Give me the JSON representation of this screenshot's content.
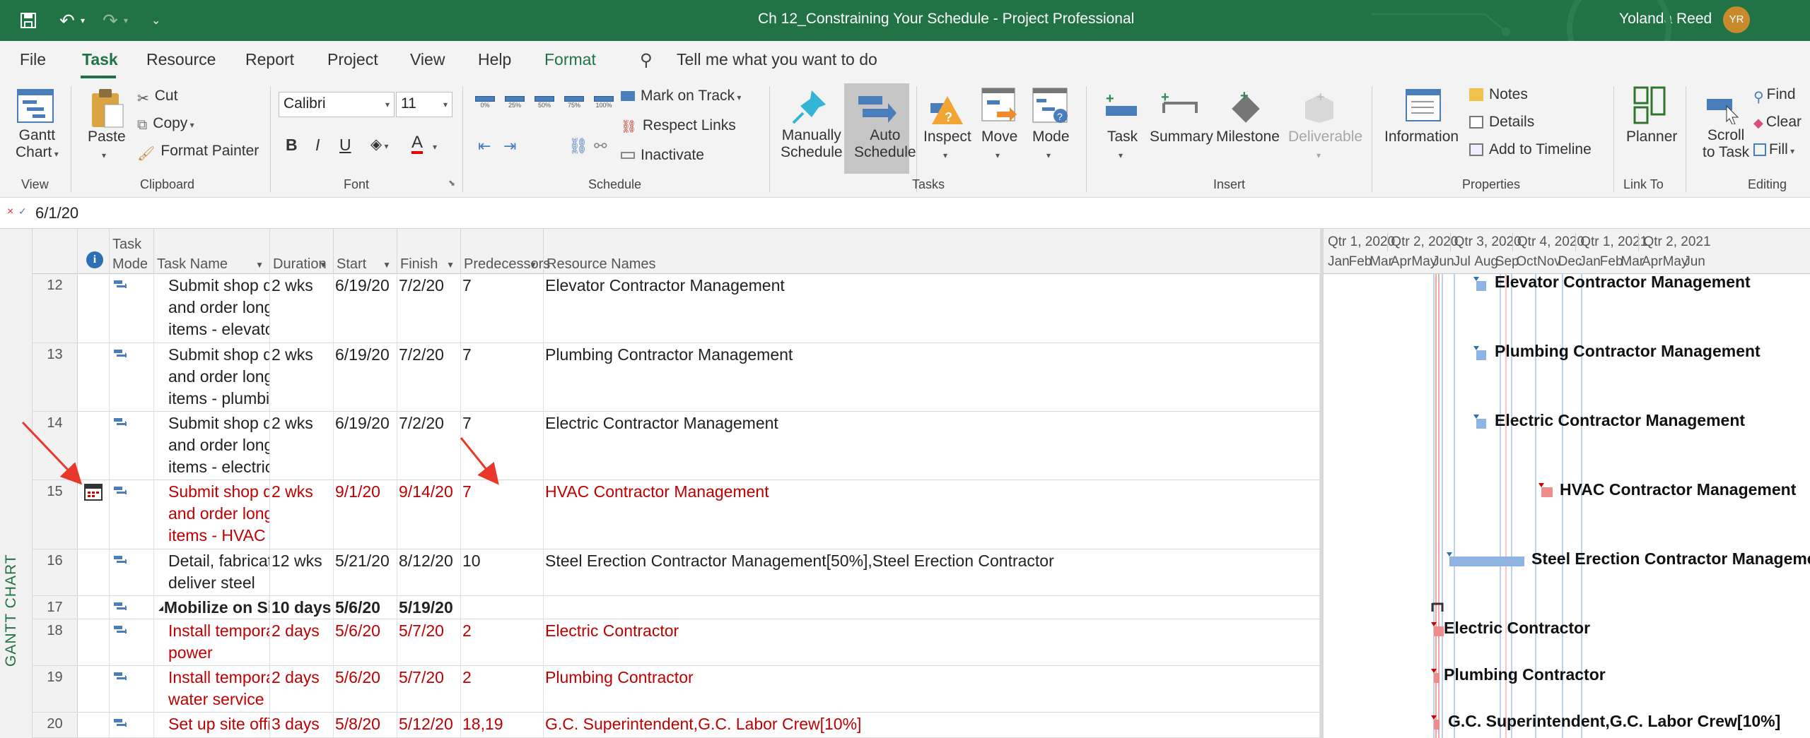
{
  "title_bar": {
    "document_title": "Ch 12_Constraining Your Schedule  -  Project Professional",
    "user_name": "Yolanda Reed",
    "user_initials": "YR",
    "qat_icons": [
      "save-icon",
      "undo-icon",
      "redo-icon",
      "customize-icon"
    ]
  },
  "menu": {
    "items": [
      "File",
      "Task",
      "Resource",
      "Report",
      "Project",
      "View",
      "Help",
      "Format"
    ],
    "active": "Task",
    "tell_me": "Tell me what you want to do"
  },
  "ribbon": {
    "view": {
      "gantt_chart": "Gantt Chart",
      "gantt_line1": "Gantt",
      "gantt_line2": "Chart",
      "group": "View"
    },
    "clipboard": {
      "paste": "Paste",
      "cut": "Cut",
      "copy": "Copy",
      "format_painter": "Format Painter",
      "group": "Clipboard"
    },
    "font": {
      "family": "Calibri",
      "size": "11",
      "bold": "B",
      "italic": "I",
      "underline": "U",
      "group": "Font"
    },
    "schedule": {
      "pct": [
        "0%",
        "25%",
        "50%",
        "75%",
        "100%"
      ],
      "mark_on_track": "Mark on Track",
      "respect_links": "Respect Links",
      "inactivate": "Inactivate",
      "group": "Schedule"
    },
    "tasks": {
      "manually_1": "Manually",
      "manually_2": "Schedule",
      "auto_1": "Auto",
      "auto_2": "Schedule",
      "inspect": "Inspect",
      "move": "Move",
      "mode": "Mode",
      "group": "Tasks"
    },
    "insert": {
      "task": "Task",
      "summary": "Summary",
      "milestone": "Milestone",
      "deliverable": "Deliverable",
      "group": "Insert"
    },
    "properties": {
      "information": "Information",
      "notes": "Notes",
      "details": "Details",
      "add_to_timeline": "Add to Timeline",
      "group": "Properties"
    },
    "link_to": {
      "planner": "Planner",
      "group": "Link To"
    },
    "editing": {
      "scroll_1": "Scroll",
      "scroll_2": "to Task",
      "find": "Find",
      "clear": "Clear",
      "fill": "Fill",
      "group": "Editing"
    }
  },
  "formula_bar": {
    "value": "6/1/20"
  },
  "gantt_view_label": "GANTT CHART",
  "table": {
    "headers": {
      "mode_1": "Task",
      "mode_2": "Mode",
      "name": "Task Name",
      "duration": "Duration",
      "start": "Start",
      "finish": "Finish",
      "predecessors": "Predecessors",
      "resources": "Resource Names"
    },
    "rows": [
      {
        "id": "12",
        "name_lines": [
          "Submit shop drawings",
          "and order long lead",
          "items - elevator"
        ],
        "duration": "2 wks",
        "start": "6/19/20",
        "finish": "7/2/20",
        "pred": "7",
        "resources": "Elevator Contractor Management"
      },
      {
        "id": "13",
        "name_lines": [
          "Submit shop drawings",
          "and order long lead",
          "items - plumbing"
        ],
        "duration": "2 wks",
        "start": "6/19/20",
        "finish": "7/2/20",
        "pred": "7",
        "resources": "Plumbing Contractor Management"
      },
      {
        "id": "14",
        "name_lines": [
          "Submit shop drawings",
          "and order long lead",
          "items - electric"
        ],
        "duration": "2 wks",
        "start": "6/19/20",
        "finish": "7/2/20",
        "pred": "7",
        "resources": "Electric Contractor Management"
      },
      {
        "id": "15",
        "name_lines": [
          "Submit shop drawings",
          "and order long lead",
          "items - HVAC"
        ],
        "duration": "2 wks",
        "start": "9/1/20",
        "finish": "9/14/20",
        "pred": "7",
        "resources": "HVAC Contractor Management"
      },
      {
        "id": "16",
        "name_lines": [
          "Detail, fabricate and",
          "deliver steel"
        ],
        "duration": "12 wks",
        "start": "5/21/20",
        "finish": "8/12/20",
        "pred": "10",
        "resources": "Steel Erection Contractor Management[50%],Steel Erection Contractor"
      },
      {
        "id": "17",
        "name_lines": [
          "Mobilize on Site"
        ],
        "duration": "10 days",
        "start": "5/6/20",
        "finish": "5/19/20",
        "pred": "",
        "resources": ""
      },
      {
        "id": "18",
        "name_lines": [
          "Install temporary",
          "power"
        ],
        "duration": "2 days",
        "start": "5/6/20",
        "finish": "5/7/20",
        "pred": "2",
        "resources": "Electric Contractor"
      },
      {
        "id": "19",
        "name_lines": [
          "Install temporary",
          "water service"
        ],
        "duration": "2 days",
        "start": "5/6/20",
        "finish": "5/7/20",
        "pred": "2",
        "resources": "Plumbing Contractor"
      },
      {
        "id": "20",
        "name_lines": [
          "Set up site office"
        ],
        "duration": "3 days",
        "start": "5/8/20",
        "finish": "5/12/20",
        "pred": "18,19",
        "resources": "G.C. Superintendent,G.C. Labor Crew[10%]"
      }
    ]
  },
  "timescale": {
    "quarters": [
      "Qtr 1, 2020",
      "Qtr 2, 2020",
      "Qtr 3, 2020",
      "Qtr 4, 2020",
      "Qtr 1, 2021",
      "Qtr 2, 2021"
    ],
    "months": [
      "Jan",
      "Feb",
      "Mar",
      "Apr",
      "May",
      "Jun",
      "Jul",
      "Aug",
      "Sep",
      "Oct",
      "Nov",
      "Dec",
      "Jan",
      "Feb",
      "Mar",
      "Apr",
      "May",
      "Jun"
    ]
  },
  "gantt_bar_labels": [
    "Elevator Contractor Management",
    "Plumbing Contractor Management",
    "Electric Contractor Management",
    "HVAC Contractor Management",
    "Steel Erection Contractor Manageme",
    "Electric Contractor",
    "Plumbing Contractor",
    "G.C. Superintendent,G.C. Labor Crew[10%]"
  ],
  "colors": {
    "brand_green": "#217346",
    "critical_red": "#c00000",
    "bar_blue": "#8fb4e3",
    "bar_red": "#f08c8c",
    "annotation_red": "#e8382b"
  }
}
